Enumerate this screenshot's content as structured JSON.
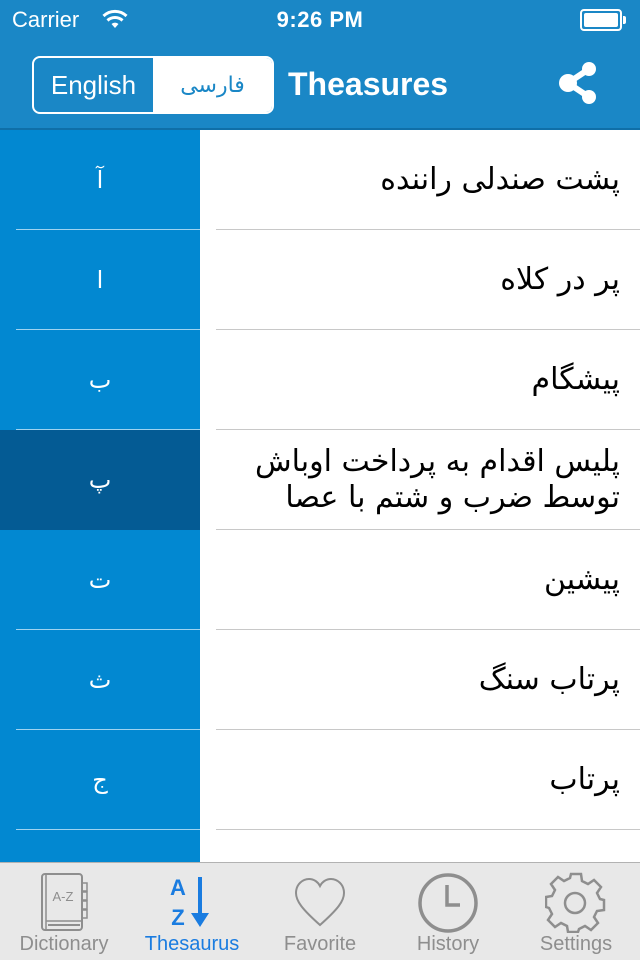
{
  "status_bar": {
    "carrier": "Carrier",
    "time": "9:26 PM"
  },
  "header": {
    "language_toggle": {
      "options": [
        "English",
        "فارسی"
      ],
      "selected": "فارسی"
    },
    "title": "Theasures",
    "share_icon": "share-icon"
  },
  "index": {
    "letters": [
      "آ",
      "ا",
      "ب",
      "پ",
      "ت",
      "ث",
      "ج",
      ""
    ],
    "selected": "پ"
  },
  "entries": [
    "پشت صندلی راننده",
    "پر در کلاه",
    "پیشگام",
    "پلیس اقدام به پرداخت اوباش توسط ضرب و شتم با عصا",
    "پیشین",
    "پرتاب سنگ",
    "پرتاب",
    ""
  ],
  "tabbar": {
    "active": "Thesaurus",
    "tabs": [
      {
        "label": "Dictionary",
        "icon": "dictionary-book-icon",
        "glyph": "A-Z"
      },
      {
        "label": "Thesaurus",
        "icon": "az-sort-icon",
        "glyph_top": "A",
        "glyph_bottom": "Z"
      },
      {
        "label": "Favorite",
        "icon": "heart-icon"
      },
      {
        "label": "History",
        "icon": "clock-icon"
      },
      {
        "label": "Settings",
        "icon": "gear-icon"
      }
    ]
  },
  "colors": {
    "header": "#1a87c6",
    "index_column": "#0288d1",
    "index_selected": "#045b94",
    "tab_active": "#1a7ce0",
    "tab_inactive": "#8e8e8e"
  }
}
